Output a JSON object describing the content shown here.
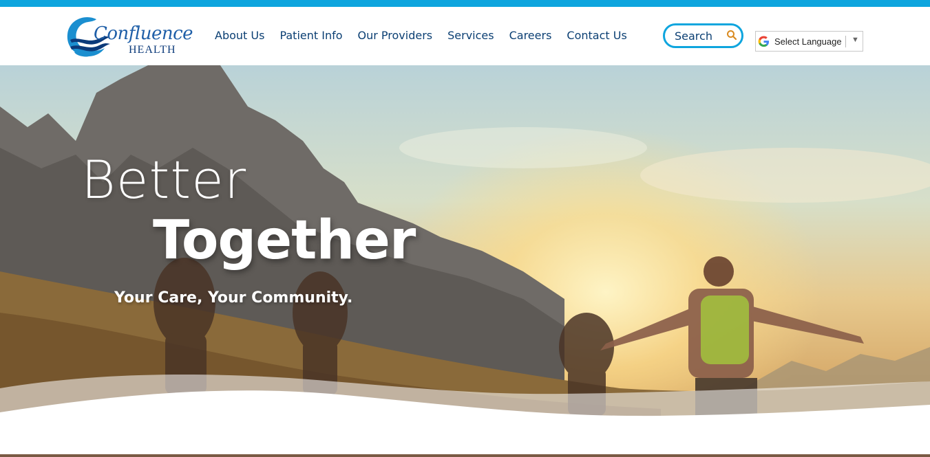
{
  "brand": {
    "name": "Confluence",
    "sub": "HEALTH",
    "accent": "#0ea5de",
    "navy": "#0b3f73"
  },
  "nav": {
    "items": [
      {
        "label": "About Us"
      },
      {
        "label": "Patient Info"
      },
      {
        "label": "Our Providers"
      },
      {
        "label": "Services"
      },
      {
        "label": "Careers"
      },
      {
        "label": "Contact Us"
      }
    ]
  },
  "search": {
    "label": "Search",
    "icon": "search-icon"
  },
  "language": {
    "label": "Select Language",
    "icon": "google-icon"
  },
  "hero": {
    "line1": "Better",
    "line2": "Together",
    "tagline": "Your Care, Your Community."
  }
}
